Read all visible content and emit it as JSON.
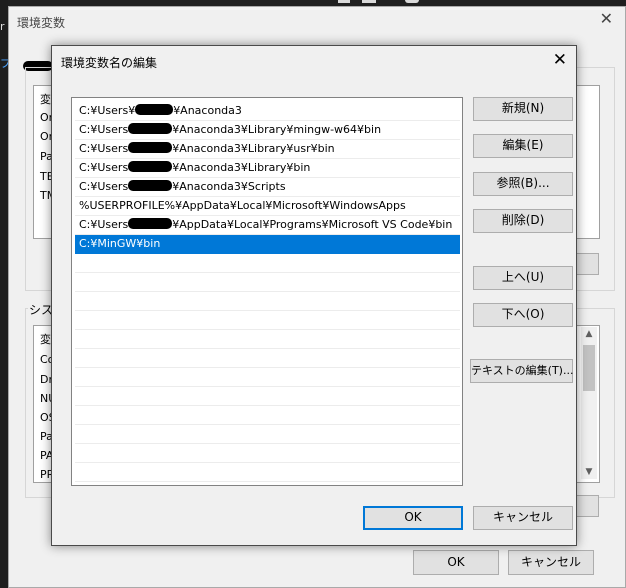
{
  "outer_window": {
    "title": "環境変数",
    "left_fragment": "r",
    "left_fragment_2": "プ",
    "user_group_col_header": "変",
    "user_vars": [
      "On",
      "On",
      "Pa",
      "TE",
      "TM"
    ],
    "system_group_label": "システ",
    "system_col_header": "変",
    "system_vars": [
      "Co",
      "Dr",
      "NU",
      "OS",
      "Pa",
      "PA",
      "PR"
    ],
    "ok_label": "OK",
    "cancel_label": "キャンセル"
  },
  "dialog": {
    "title": "環境変数名の編集",
    "path_items": [
      {
        "prefix": "C:¥Users¥",
        "suffix": "¥Anaconda3"
      },
      {
        "prefix": "C:¥Users",
        "suffix": "¥Anaconda3¥Library¥mingw-w64¥bin"
      },
      {
        "prefix": "C:¥Users",
        "suffix": "¥Anaconda3¥Library¥usr¥bin"
      },
      {
        "prefix": "C:¥Users",
        "suffix": "¥Anaconda3¥Library¥bin"
      },
      {
        "prefix": "C:¥Users",
        "suffix": "¥Anaconda3¥Scripts"
      },
      {
        "prefix": "%USERPROFILE%¥AppData¥Local¥Microsoft¥WindowsApps",
        "suffix": ""
      },
      {
        "prefix": "C:¥Users",
        "suffix": "¥AppData¥Local¥Programs¥Microsoft VS Code¥bin"
      },
      {
        "prefix": "C:¥MinGW¥bin",
        "suffix": ""
      }
    ],
    "selected_index": 7,
    "buttons": {
      "new": "新規(N)",
      "edit": "編集(E)",
      "browse": "参照(B)...",
      "delete": "削除(D)",
      "move_up": "上へ(U)",
      "move_down": "下へ(O)",
      "edit_text": "テキストの編集(T)...",
      "ok": "OK",
      "cancel": "キャンセル"
    },
    "colors": {
      "selection": "#0078d7",
      "default_border": "#0078d7"
    }
  }
}
